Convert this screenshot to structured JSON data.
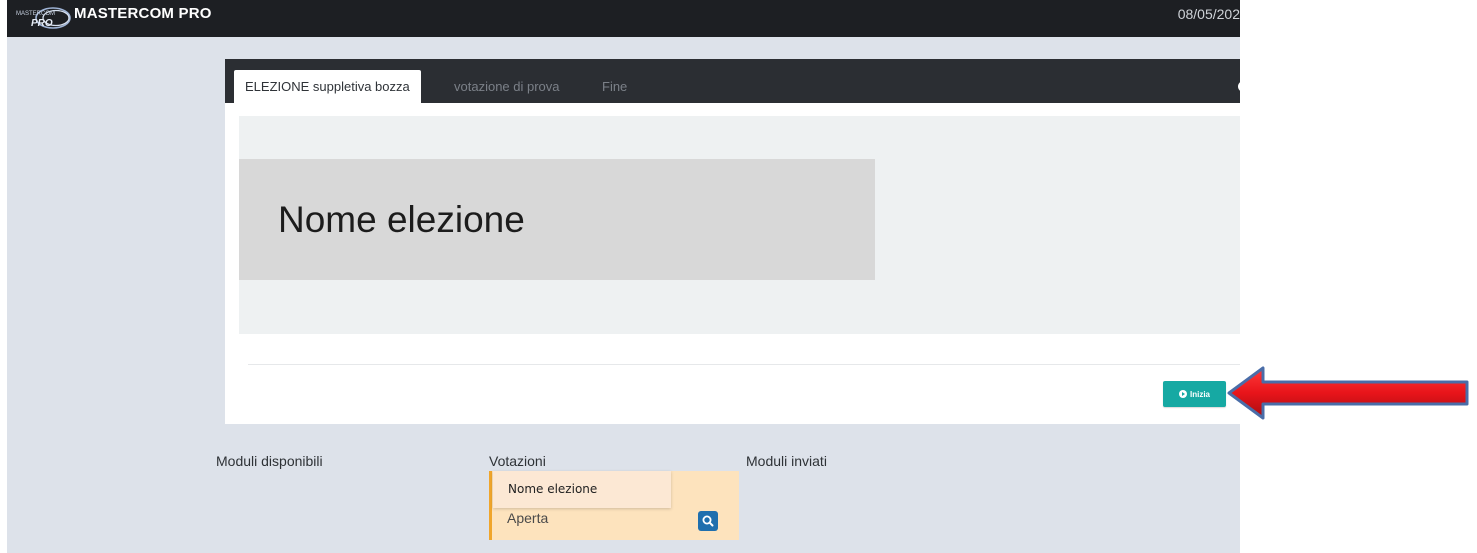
{
  "app": {
    "title": "MASTERCOM PRO",
    "logo_text": "MASTERCOM PRO",
    "date": "08/05/202"
  },
  "tabs": [
    {
      "label": "ELEZIONE suppletiva bozza",
      "active": true
    },
    {
      "label": "votazione di prova",
      "active": false
    },
    {
      "label": "Fine",
      "active": false
    }
  ],
  "election": {
    "name": "Nome elezione"
  },
  "buttons": {
    "start": "Inizia"
  },
  "columns": {
    "available": "Moduli disponibili",
    "votes": "Votazioni",
    "sent": "Moduli inviati"
  },
  "vote_item": {
    "name": "Nome elezione",
    "status": "Aperta"
  },
  "colors": {
    "accent_teal": "#16a9a3",
    "topbar": "#1d1f23",
    "annotation_arrow": "#e8141a",
    "card_border": "#f0a52b"
  }
}
